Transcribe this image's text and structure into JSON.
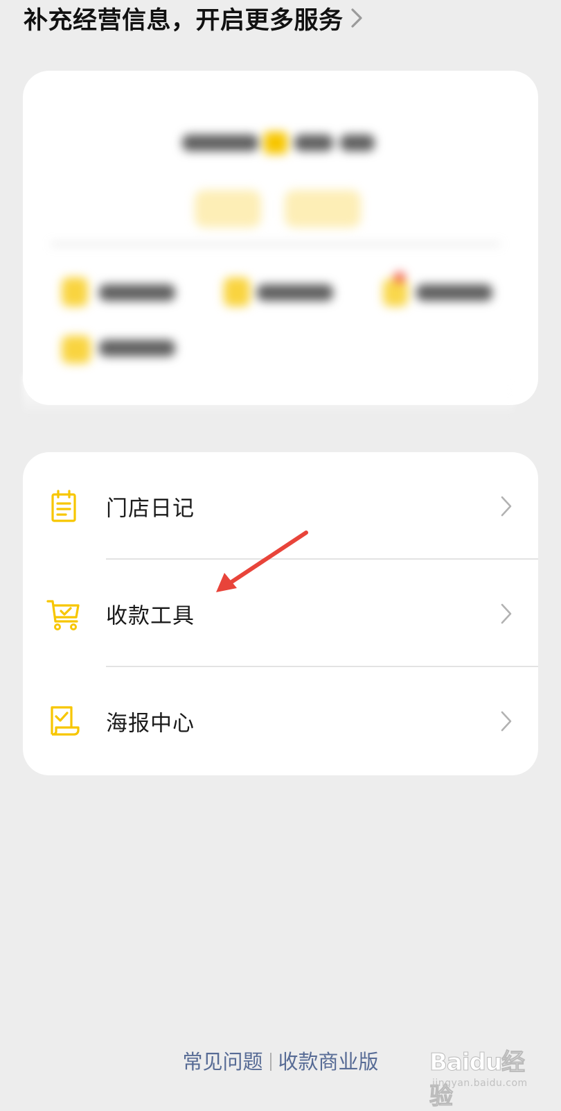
{
  "banner": {
    "text": "补充经营信息，开启更多服务",
    "chevron_icon": "chevron-right-icon"
  },
  "menu": {
    "items": [
      {
        "label": "门店日记",
        "icon": "notepad-icon",
        "chevron_icon": "chevron-right-icon"
      },
      {
        "label": "收款工具",
        "icon": "shopping-cart-icon",
        "chevron_icon": "chevron-right-icon"
      },
      {
        "label": "海报中心",
        "icon": "poster-checklist-icon",
        "chevron_icon": "chevron-right-icon"
      }
    ]
  },
  "footer": {
    "link_faq": "常见问题",
    "link_business": "收款商业版"
  },
  "watermark": {
    "logo_text": "Baidu经验",
    "sub_text": "jingyan.baidu.com"
  },
  "colors": {
    "background": "#ededed",
    "card": "#ffffff",
    "icon_accent": "#f7c600",
    "link": "#576b95",
    "chevron": "#b2b2b2",
    "annotation_arrow": "#e8443a"
  }
}
